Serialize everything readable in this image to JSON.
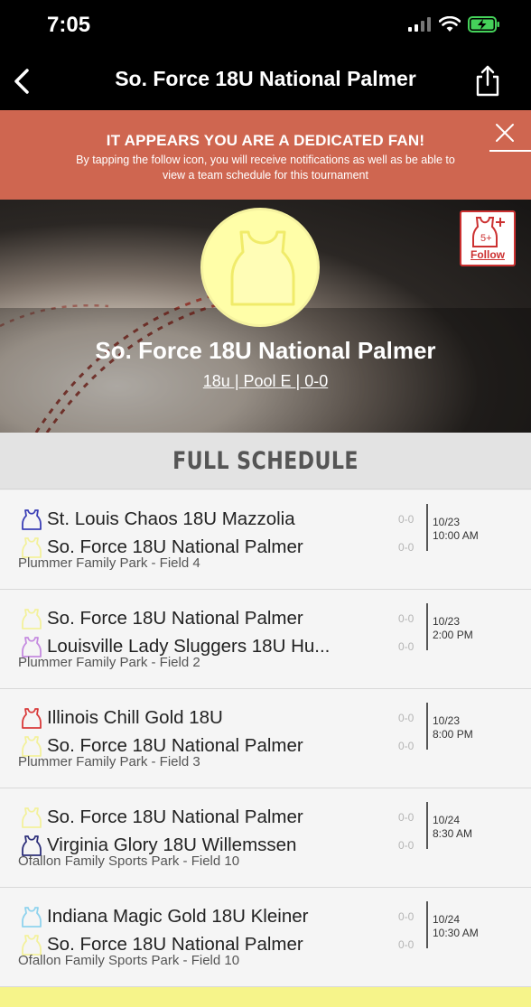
{
  "status_bar": {
    "time": "7:05"
  },
  "nav": {
    "title": "So. Force 18U National Palmer"
  },
  "banner": {
    "title": "IT APPEARS YOU ARE A DEDICATED FAN!",
    "text": "By tapping the follow icon, you will receive notifications as well as be able to view a team schedule for this tournament"
  },
  "hero": {
    "team_name": "So. Force 18U National Palmer",
    "subtitle": "18u | Pool E | 0-0",
    "follow_label": "Follow",
    "follow_badge": "5+"
  },
  "section": {
    "title": "FULL SCHEDULE"
  },
  "colors": {
    "banner_bg": "#cf6650",
    "jersey_yellow": "#fffea8",
    "follow_red": "#cc3131"
  },
  "games": [
    {
      "team1": {
        "name": "St. Louis Chaos 18U Mazzolia",
        "score": "0-0",
        "jersey_color": "#3b3fb6"
      },
      "team2": {
        "name": "So. Force 18U National Palmer",
        "score": "0-0",
        "jersey_color": "#f3f19c"
      },
      "date": "10/23",
      "time": "10:00 AM",
      "venue": "Plummer Family Park - Field 4"
    },
    {
      "team1": {
        "name": "So. Force 18U National Palmer",
        "score": "0-0",
        "jersey_color": "#f3f19c"
      },
      "team2": {
        "name": "Louisville Lady Sluggers 18U Hu...",
        "score": "0-0",
        "jersey_color": "#c58be0"
      },
      "date": "10/23",
      "time": "2:00 PM",
      "venue": "Plummer Family Park - Field 2"
    },
    {
      "team1": {
        "name": "Illinois Chill Gold 18U",
        "score": "0-0",
        "jersey_color": "#d93a3a"
      },
      "team2": {
        "name": "So. Force 18U National Palmer",
        "score": "0-0",
        "jersey_color": "#f3f19c"
      },
      "date": "10/23",
      "time": "8:00 PM",
      "venue": "Plummer Family Park - Field 3"
    },
    {
      "team1": {
        "name": "So. Force 18U National Palmer",
        "score": "0-0",
        "jersey_color": "#f3f19c"
      },
      "team2": {
        "name": "Virginia Glory 18U Willemssen",
        "score": "0-0",
        "jersey_color": "#2d2f7a"
      },
      "date": "10/24",
      "time": "8:30 AM",
      "venue": "Ofallon Family Sports Park - Field 10"
    },
    {
      "team1": {
        "name": "Indiana Magic Gold 18U Kleiner",
        "score": "0-0",
        "jersey_color": "#8fd3ee"
      },
      "team2": {
        "name": "So. Force 18U National Palmer",
        "score": "0-0",
        "jersey_color": "#f3f19c"
      },
      "date": "10/24",
      "time": "10:30 AM",
      "venue": "Ofallon Family Sports Park - Field 10"
    }
  ]
}
